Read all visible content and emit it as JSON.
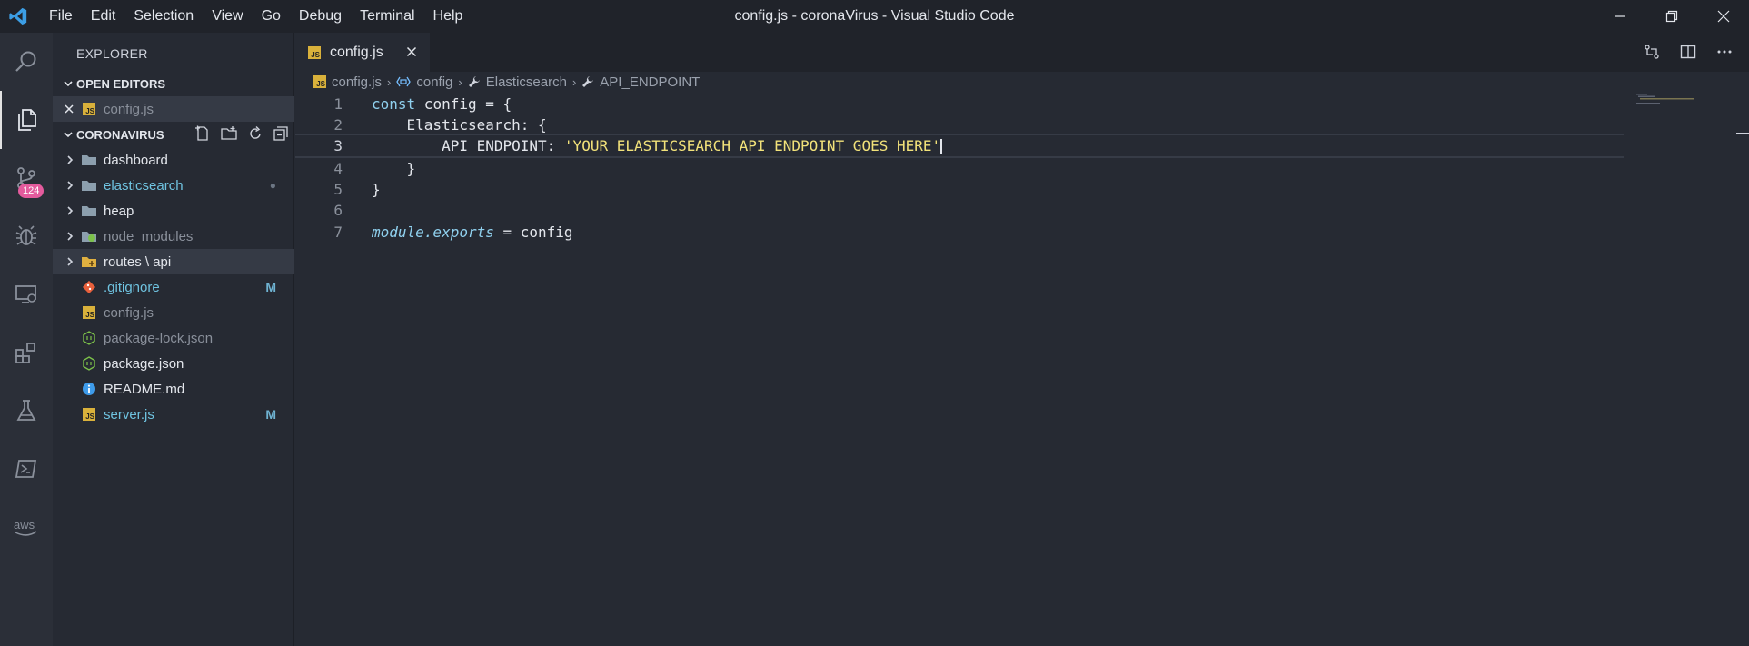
{
  "titlebar": {
    "menu": [
      "File",
      "Edit",
      "Selection",
      "View",
      "Go",
      "Debug",
      "Terminal",
      "Help"
    ],
    "window_title": "config.js - coronaVirus - Visual Studio Code"
  },
  "activitybar": {
    "scm_badge": "124",
    "icons": [
      "search-icon",
      "files-icon",
      "source-control-icon",
      "debug-icon",
      "remote-explorer-icon",
      "extensions-icon",
      "test-flask-icon",
      "powershell-icon",
      "aws-icon"
    ]
  },
  "sidebar": {
    "title": "EXPLORER",
    "open_editors": {
      "label": "OPEN EDITORS",
      "items": [
        {
          "name": "config.js"
        }
      ]
    },
    "workspace": {
      "label": "CORONAVIRUS",
      "items": [
        {
          "name": "dashboard",
          "type": "folder",
          "color": "#e3e6ec"
        },
        {
          "name": "elasticsearch",
          "type": "folder",
          "color": "#6fc3e0",
          "status": "●"
        },
        {
          "name": "heap",
          "type": "folder",
          "color": "#e3e6ec"
        },
        {
          "name": "node_modules",
          "type": "folder-node",
          "color": "#8a909b"
        },
        {
          "name": "routes \\ api",
          "type": "folder-special",
          "color": "#e3e6ec"
        },
        {
          "name": ".gitignore",
          "type": "git",
          "color": "#6fc3e0",
          "status": "M"
        },
        {
          "name": "config.js",
          "type": "js",
          "color": "#8a909b"
        },
        {
          "name": "package-lock.json",
          "type": "node",
          "color": "#8a909b"
        },
        {
          "name": "package.json",
          "type": "node",
          "color": "#e3e6ec"
        },
        {
          "name": "README.md",
          "type": "info",
          "color": "#e3e6ec"
        },
        {
          "name": "server.js",
          "type": "js",
          "color": "#6fc3e0",
          "status": "M"
        }
      ]
    }
  },
  "editor": {
    "tab": "config.js",
    "breadcrumbs": [
      "config.js",
      "config",
      "Elasticsearch",
      "API_ENDPOINT"
    ],
    "lines": [
      {
        "n": "1",
        "indent": "",
        "a": "const",
        "b": " config = {",
        "c": ""
      },
      {
        "n": "2",
        "indent": "    ",
        "a": "",
        "b": "Elasticsearch: {",
        "c": ""
      },
      {
        "n": "3",
        "indent": "        ",
        "a": "",
        "b": "API_ENDPOINT: ",
        "c": "'YOUR_ELASTICSEARCH_API_ENDPOINT_GOES_HERE'"
      },
      {
        "n": "4",
        "indent": "    ",
        "a": "",
        "b": "}",
        "c": ""
      },
      {
        "n": "5",
        "indent": "",
        "a": "",
        "b": "}",
        "c": ""
      },
      {
        "n": "6",
        "indent": "",
        "a": "",
        "b": "",
        "c": ""
      },
      {
        "n": "7",
        "indent": "",
        "a": "module.exports",
        "b": " = config",
        "c": ""
      }
    ]
  }
}
